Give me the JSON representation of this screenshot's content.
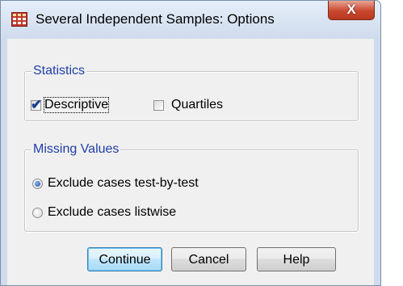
{
  "window": {
    "title": "Several Independent Samples: Options",
    "close_label": "X"
  },
  "statistics": {
    "legend": "Statistics",
    "descriptive": {
      "label": "Descriptive",
      "checked": true
    },
    "quartiles": {
      "label": "Quartiles",
      "checked": false
    }
  },
  "missing_values": {
    "legend": "Missing Values",
    "options": [
      {
        "label": "Exclude cases test-by-test",
        "selected": true
      },
      {
        "label": "Exclude cases listwise",
        "selected": false
      }
    ]
  },
  "buttons": {
    "continue": "Continue",
    "cancel": "Cancel",
    "help": "Help"
  },
  "colors": {
    "legend_text": "#1f3ea6",
    "client_bg": "#f0f0f0",
    "close_button": "#c9472f",
    "default_button_border": "#3c7fb1"
  },
  "icons": {
    "app": "spss-table-icon",
    "close": "close-icon",
    "check": "checkmark-icon",
    "radio_dot": "radio-dot-icon"
  }
}
